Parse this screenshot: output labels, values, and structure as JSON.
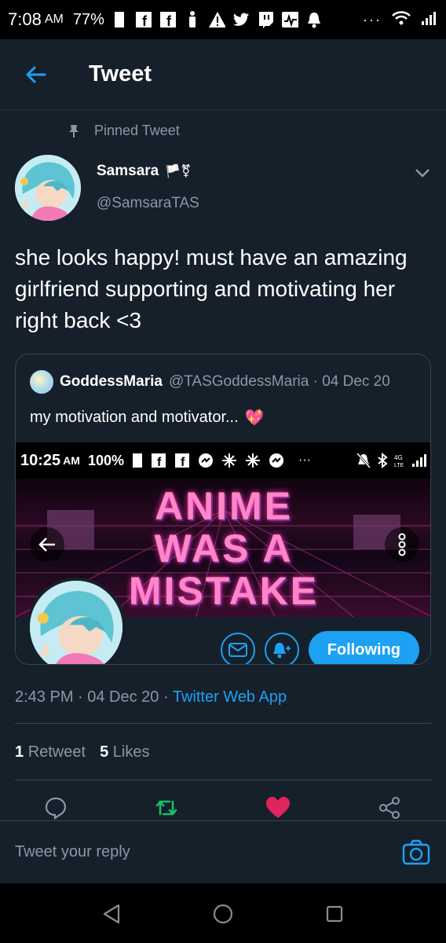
{
  "status_bar": {
    "time": "7:08",
    "ampm": "AM",
    "battery": "77%",
    "icons": [
      "sim-card-icon",
      "facebook-icon",
      "facebook-icon",
      "accessibility-icon",
      "warning-icon",
      "twitter-icon",
      "twitch-icon",
      "activity-icon",
      "notification-bell-icon",
      "more-dots-icon",
      "wifi-icon",
      "signal-icon"
    ]
  },
  "header": {
    "title": "Tweet"
  },
  "pinned": {
    "label": "Pinned Tweet"
  },
  "tweet": {
    "name": "Samsara",
    "name_emoji": "🏳️⚧",
    "handle": "@SamsaraTAS",
    "text": "she looks happy! must have an amazing girlfriend supporting and motivating her right back <3",
    "timestamp": "2:43 PM · 04 Dec 20 · ",
    "source": "Twitter Web App",
    "retweets_count": "1",
    "retweets_label": "Retweet",
    "likes_count": "5",
    "likes_label": "Likes"
  },
  "quote": {
    "name": "GoddessMaria",
    "handle_date": "@TASGoddessMaria · 04 Dec 20",
    "text": "my motivation and motivator...",
    "emoji": "💖",
    "media": {
      "time": "10:25",
      "ampm": "AM",
      "battery": "100%",
      "banner_lines": [
        "ANIME",
        "WAS A",
        "MISTAKE"
      ],
      "follow_label": "Following"
    }
  },
  "reply": {
    "placeholder": "Tweet your reply"
  },
  "colors": {
    "background": "#15202b",
    "accent": "#1da1f2",
    "retweet": "#17bf63",
    "like": "#e0245e",
    "muted": "#8899a6"
  }
}
